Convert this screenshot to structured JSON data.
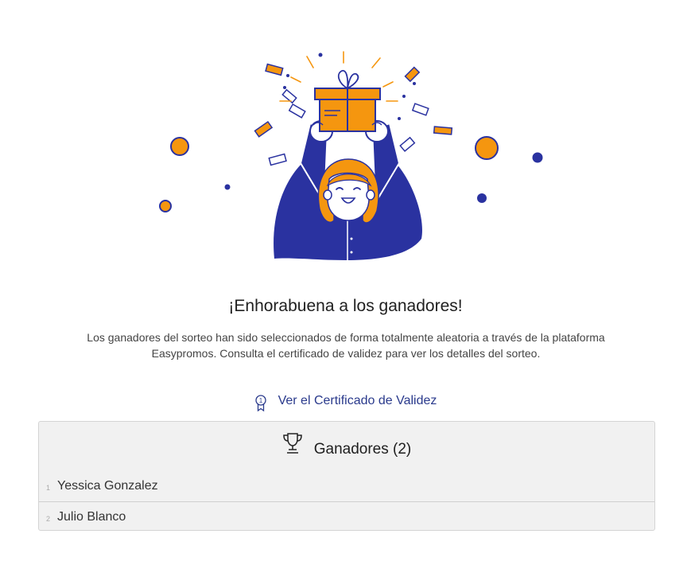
{
  "header": {
    "title": "¡Enhorabuena a los ganadores!",
    "description": "Los ganadores del sorteo han sido seleccionados de forma totalmente aleatoria a través de la plataforma Easypromos. Consulta el certificado de validez para ver los detalles del sorteo."
  },
  "certificate": {
    "icon": "certificate-badge-icon",
    "label": "Ver el Certificado de Validez"
  },
  "winners": {
    "icon": "trophy-icon",
    "title": "Ganadores (2)",
    "list": [
      {
        "index": "1",
        "name": "Yessica Gonzalez"
      },
      {
        "index": "2",
        "name": "Julio Blanco"
      }
    ]
  },
  "colors": {
    "orange": "#f5960f",
    "navy": "#2a32a0",
    "link": "#2a3a8c",
    "panel_bg": "#f1f1f1"
  }
}
